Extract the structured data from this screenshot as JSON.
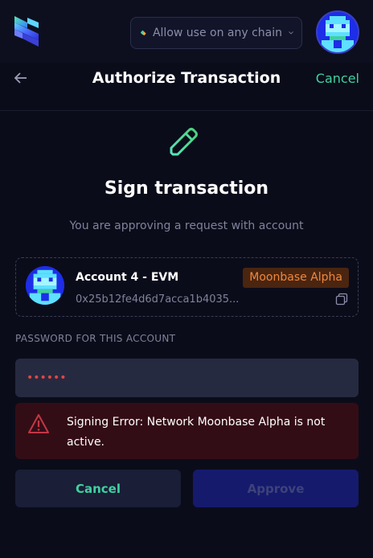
{
  "topbar": {
    "chain_selector_label": "Allow use on any chain"
  },
  "header": {
    "title": "Authorize Transaction",
    "cancel_label": "Cancel"
  },
  "sign": {
    "title": "Sign transaction",
    "subtitle": "You are approving a request with account"
  },
  "account": {
    "name": "Account 4 - EVM",
    "network": "Moonbase Alpha",
    "address": "0x25b12fe4d6d7acca1b4035..."
  },
  "password": {
    "label": "PASSWORD FOR THIS ACCOUNT",
    "value": "••••••"
  },
  "error": {
    "message": "Signing Error: Network Moonbase Alpha is not active."
  },
  "actions": {
    "cancel_label": "Cancel",
    "approve_label": "Approve"
  },
  "colors": {
    "accent_green": "#3fd1a0",
    "network_badge_text": "#f0873c",
    "error_bg": "#330d16",
    "error_red": "#e04646",
    "approve_bg": "#151a6d"
  },
  "icons": {
    "logo": "subwallet-logo",
    "back": "arrow-left-icon",
    "sign": "pencil-icon",
    "copy": "copy-icon",
    "warning": "warning-icon",
    "chain": "chain-icon",
    "dropdown": "chevron-down-icon"
  }
}
